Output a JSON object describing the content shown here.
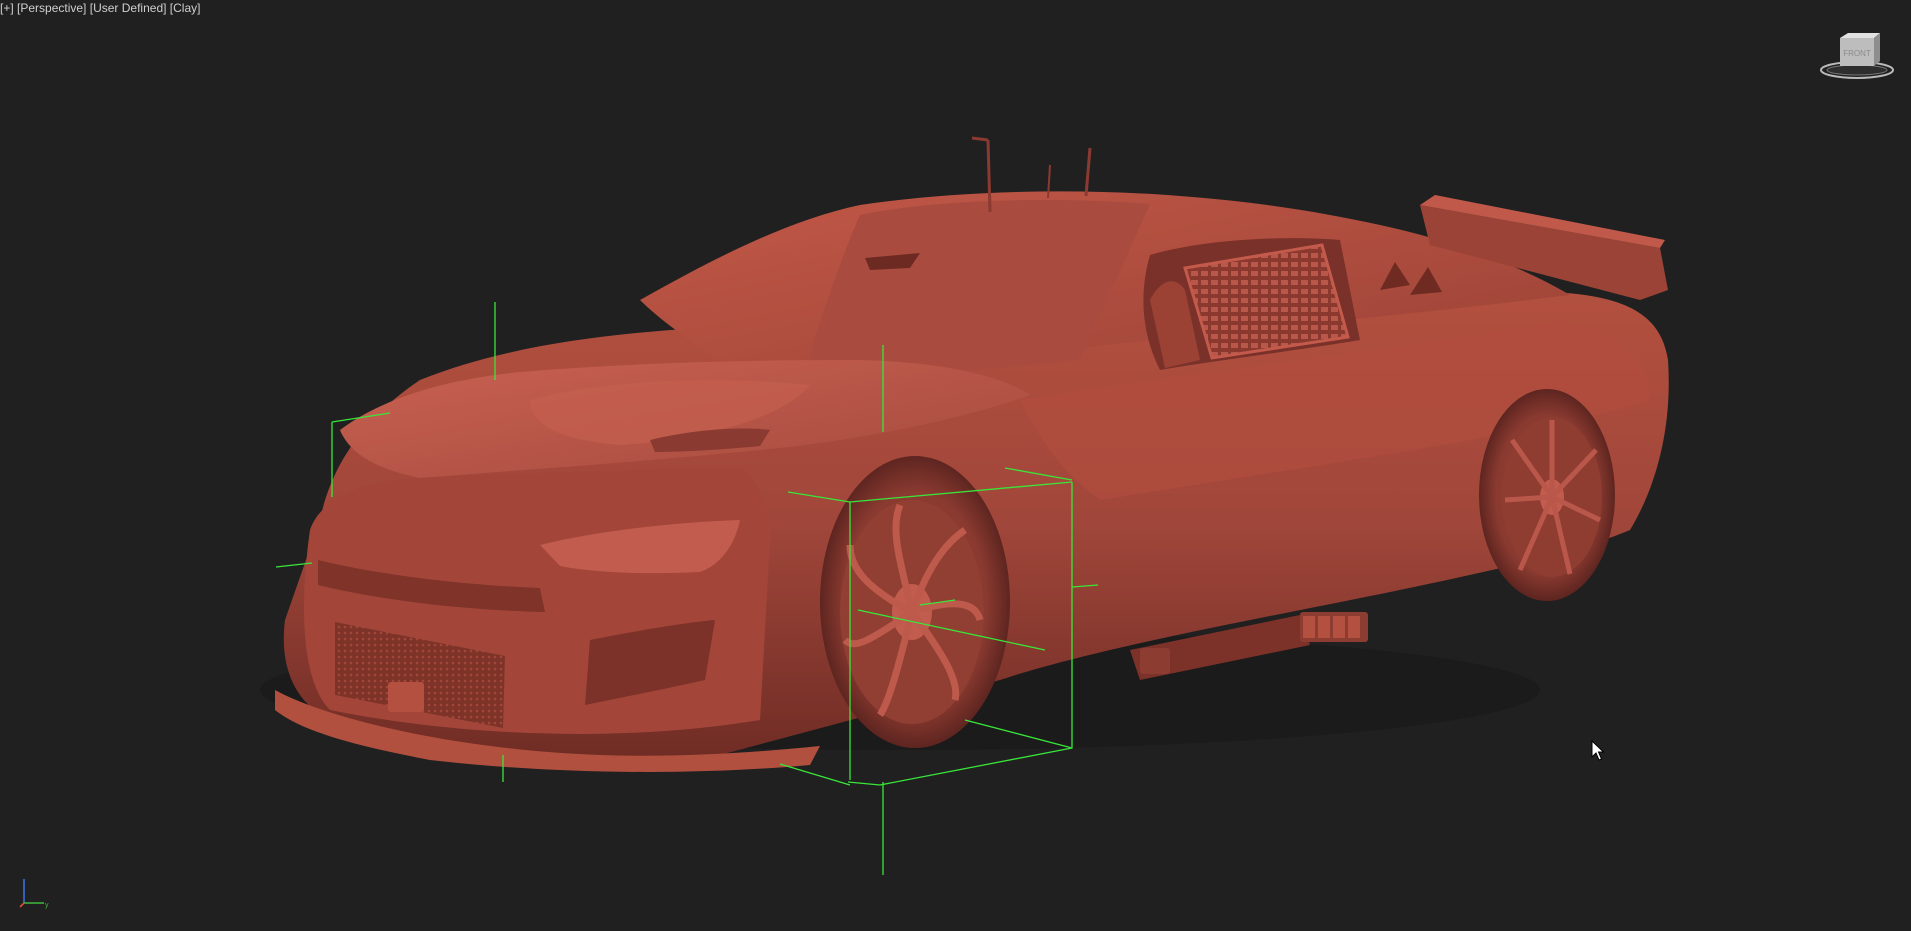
{
  "viewport": {
    "label_parts": [
      "[+]",
      "[Perspective]",
      "[User Defined]",
      "[Clay]"
    ],
    "viewcube_face": "FRONT",
    "axes": {
      "x": "x",
      "y": "y",
      "z": "z"
    },
    "scene_object": "race-car-model",
    "colors": {
      "background": "#202020",
      "clay": "#a8493c",
      "clay_light": "#c4594a",
      "clay_dark": "#6e2a22",
      "gizmo": "#39e63a"
    },
    "icons": [
      "viewcube-icon",
      "axis-tripod-icon",
      "mouse-cursor-icon"
    ]
  }
}
